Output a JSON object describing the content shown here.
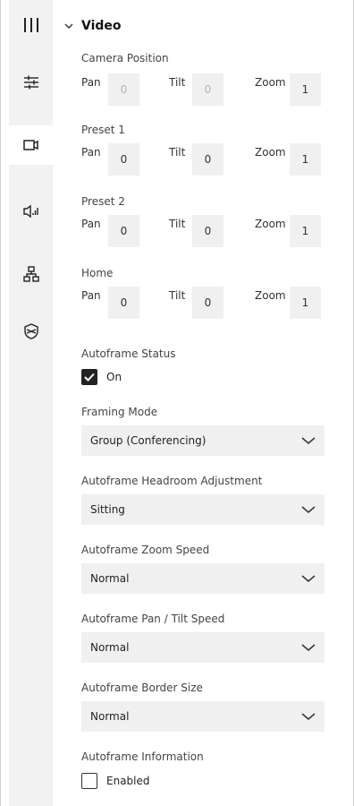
{
  "section": {
    "title": "Video"
  },
  "camera_position": {
    "label": "Camera Position",
    "pan_label": "Pan",
    "pan": "0",
    "tilt_label": "Tilt",
    "tilt": "0",
    "zoom_label": "Zoom",
    "zoom": "1"
  },
  "preset1": {
    "label": "Preset 1",
    "pan_label": "Pan",
    "pan": "0",
    "tilt_label": "Tilt",
    "tilt": "0",
    "zoom_label": "Zoom",
    "zoom": "1"
  },
  "preset2": {
    "label": "Preset 2",
    "pan_label": "Pan",
    "pan": "0",
    "tilt_label": "Tilt",
    "tilt": "0",
    "zoom_label": "Zoom",
    "zoom": "1"
  },
  "home": {
    "label": "Home",
    "pan_label": "Pan",
    "pan": "0",
    "tilt_label": "Tilt",
    "tilt": "0",
    "zoom_label": "Zoom",
    "zoom": "1"
  },
  "autoframe_status": {
    "label": "Autoframe Status",
    "option": "On",
    "checked": true
  },
  "framing_mode": {
    "label": "Framing Mode",
    "value": "Group (Conferencing)"
  },
  "headroom": {
    "label": "Autoframe Headroom Adjustment",
    "value": "Sitting"
  },
  "zoom_speed": {
    "label": "Autoframe Zoom Speed",
    "value": "Normal"
  },
  "pan_tilt_speed": {
    "label": "Autoframe Pan / Tilt Speed",
    "value": "Normal"
  },
  "border_size": {
    "label": "Autoframe Border Size",
    "value": "Normal"
  },
  "autoframe_info": {
    "label": "Autoframe Information",
    "option": "Enabled",
    "checked": false
  },
  "sidebar": {
    "items": [
      {
        "icon": "columns-icon"
      },
      {
        "icon": "sliders-icon"
      },
      {
        "icon": "video-camera-icon",
        "active": true
      },
      {
        "icon": "speaker-icon"
      },
      {
        "icon": "network-icon"
      },
      {
        "icon": "shield-icon"
      }
    ]
  },
  "colors": {
    "sidebar_bg": "#f2f2f2",
    "field_bg": "#f0f0f0",
    "text": "#222222"
  }
}
